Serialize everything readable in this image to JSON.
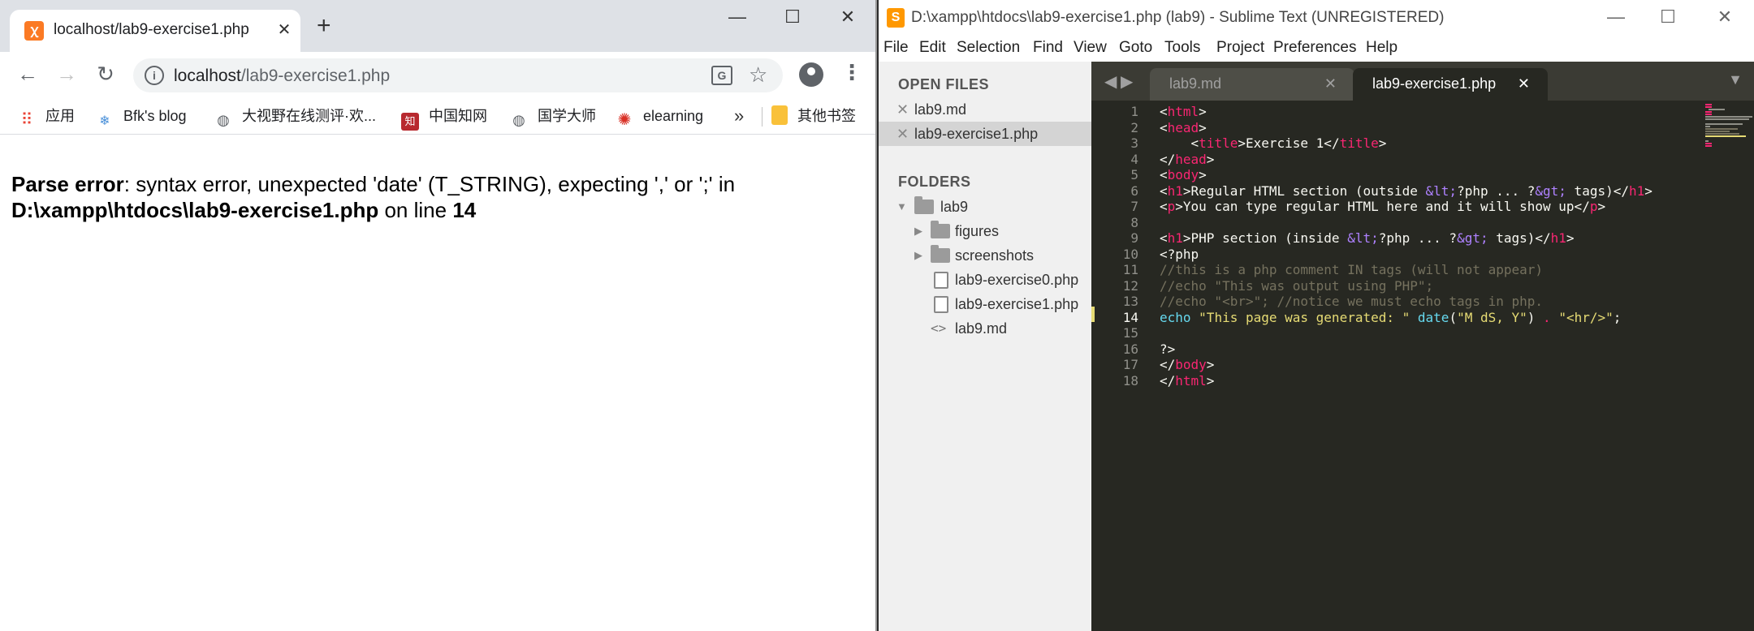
{
  "chrome": {
    "tab_title": "localhost/lab9-exercise1.php",
    "tab_favicon": "xampp-icon",
    "new_tab_label": "+",
    "window_controls": {
      "minimize": "—",
      "maximize": "☐",
      "close": "✕"
    },
    "url_host": "localhost",
    "url_path": "/lab9-exercise1.php",
    "bookmarks": [
      {
        "label": "应用",
        "icon": "apps-grid-icon",
        "color": "#ea4335"
      },
      {
        "label": "Bfk's blog",
        "icon": "snowflake-icon",
        "color": "#4a90d9"
      },
      {
        "label": "大视野在线测评·欢...",
        "icon": "globe-icon",
        "color": "#5f6368"
      },
      {
        "label": "中国知网",
        "icon": "cnki-icon",
        "color": "#b8292f"
      },
      {
        "label": "国学大师",
        "icon": "globe-icon",
        "color": "#5f6368"
      },
      {
        "label": "elearning",
        "icon": "elearning-icon",
        "color": "#d93025"
      },
      {
        "label": "其他书签",
        "icon": "folder-icon",
        "color": "#f9c13a"
      }
    ],
    "bookmarks_more": "»",
    "error": {
      "label": "Parse error",
      "message": ": syntax error, unexpected 'date' (T_STRING), expecting ',' or ';' in",
      "path": "D:\\xampp\\htdocs\\lab9-exercise1.php",
      "on_line": " on line ",
      "line": "14"
    }
  },
  "sublime": {
    "title": "D:\\xampp\\htdocs\\lab9-exercise1.php (lab9) - Sublime Text (UNREGISTERED)",
    "menu": [
      "File",
      "Edit",
      "Selection",
      "Find",
      "View",
      "Goto",
      "Tools",
      "Project",
      "Preferences",
      "Help"
    ],
    "sidebar": {
      "open_files_header": "OPEN FILES",
      "open_files": [
        "lab9.md",
        "lab9-exercise1.php"
      ],
      "folders_header": "FOLDERS",
      "root_folder": "lab9",
      "subfolders": [
        "figures",
        "screenshots"
      ],
      "files": [
        "lab9-exercise0.php",
        "lab9-exercise1.php",
        "lab9.md"
      ]
    },
    "tabs": [
      "lab9.md",
      "lab9-exercise1.php"
    ],
    "tab_close": "✕",
    "current_line": 14,
    "line_numbers": [
      "1",
      "2",
      "3",
      "4",
      "5",
      "6",
      "7",
      "8",
      "9",
      "10",
      "11",
      "12",
      "13",
      "14",
      "15",
      "16",
      "17",
      "18"
    ]
  },
  "colors": {
    "sublime_bg": "#272822",
    "tag": "#f92672",
    "entity": "#ae81ff",
    "comment": "#75715e",
    "function": "#66d9ef",
    "string": "#e6db74",
    "text": "#f8f8f2"
  }
}
